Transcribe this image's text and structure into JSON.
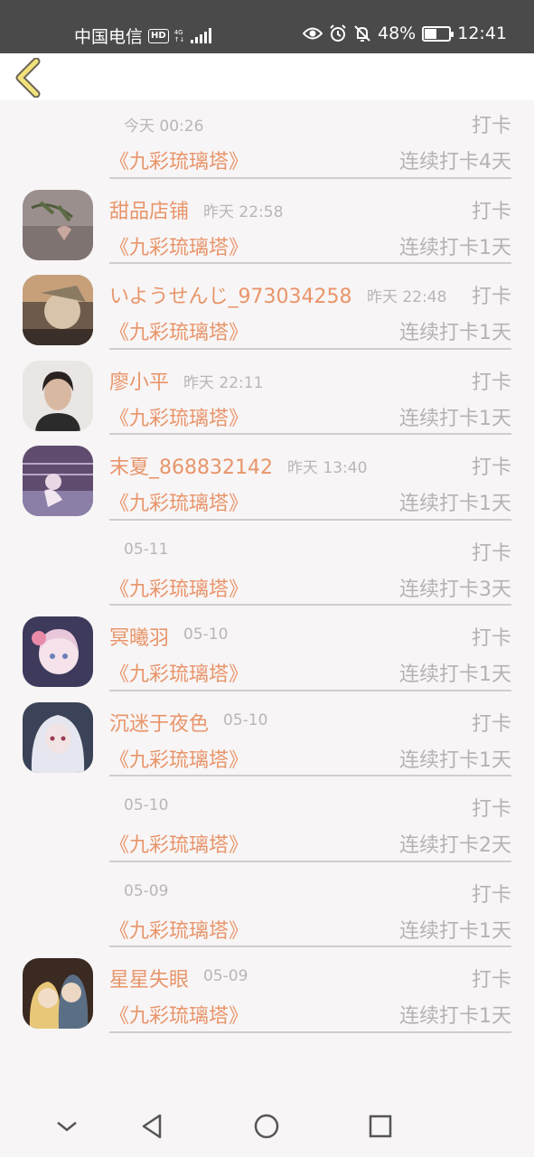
{
  "status_bar": {
    "carrier": "中国电信",
    "hd": "HD",
    "network_top": "4G",
    "network_bottom": "↑↓",
    "battery": "48%",
    "battery_level": 0.48,
    "time": "12:41",
    "icons": [
      "eye-icon",
      "alarm-icon",
      "bell-off-icon",
      "battery-icon"
    ]
  },
  "header": {
    "back_icon": "chevron-left-icon"
  },
  "records": [
    {
      "name": "",
      "time": "今天 00:26",
      "tag": "打卡",
      "book": "《九彩琉璃塔》",
      "streak": "连续打卡4天",
      "avatar": null
    },
    {
      "name": "甜品店铺",
      "time": "昨天 22:58",
      "tag": "打卡",
      "book": "《九彩琉璃塔》",
      "streak": "连续打卡1天",
      "avatar": "bamboo-avatar"
    },
    {
      "name": "いようせんじ_973034258",
      "time": "昨天 22:48",
      "tag": "打卡",
      "book": "《九彩琉璃塔》",
      "streak": "连续打卡1天",
      "avatar": "warrior-avatar"
    },
    {
      "name": "廖小平",
      "time": "昨天 22:11",
      "tag": "打卡",
      "book": "《九彩琉璃塔》",
      "streak": "连续打卡1天",
      "avatar": "woman-photo-avatar"
    },
    {
      "name": "末夏_868832142",
      "time": "昨天 13:40",
      "tag": "打卡",
      "book": "《九彩琉璃塔》",
      "streak": "连续打卡1天",
      "avatar": "purple-girl-avatar"
    },
    {
      "name": "",
      "time": "05-11",
      "tag": "打卡",
      "book": "《九彩琉璃塔》",
      "streak": "连续打卡3天",
      "avatar": null
    },
    {
      "name": "冥曦羽",
      "time": "05-10",
      "tag": "打卡",
      "book": "《九彩琉璃塔》",
      "streak": "连续打卡1天",
      "avatar": "flower-girl-avatar"
    },
    {
      "name": "沉迷于夜色",
      "time": "05-10",
      "tag": "打卡",
      "book": "《九彩琉璃塔》",
      "streak": "连续打卡1天",
      "avatar": "white-hair-girl-avatar"
    },
    {
      "name": "",
      "time": "05-10",
      "tag": "打卡",
      "book": "《九彩琉璃塔》",
      "streak": "连续打卡2天",
      "avatar": null
    },
    {
      "name": "",
      "time": "05-09",
      "tag": "打卡",
      "book": "《九彩琉璃塔》",
      "streak": "连续打卡1天",
      "avatar": null
    },
    {
      "name": "星星失眼",
      "time": "05-09",
      "tag": "打卡",
      "book": "《九彩琉璃塔》",
      "streak": "连续打卡1天",
      "avatar": "couple-avatar"
    }
  ],
  "nav_bar": {
    "icons": [
      "collapse-down-icon",
      "back-triangle-icon",
      "home-circle-icon",
      "recents-square-icon"
    ]
  },
  "colors": {
    "accent": "#e8956a",
    "muted": "#b6b2b2",
    "background": "#f8f5f6",
    "statusbar": "#4a4a4a"
  }
}
